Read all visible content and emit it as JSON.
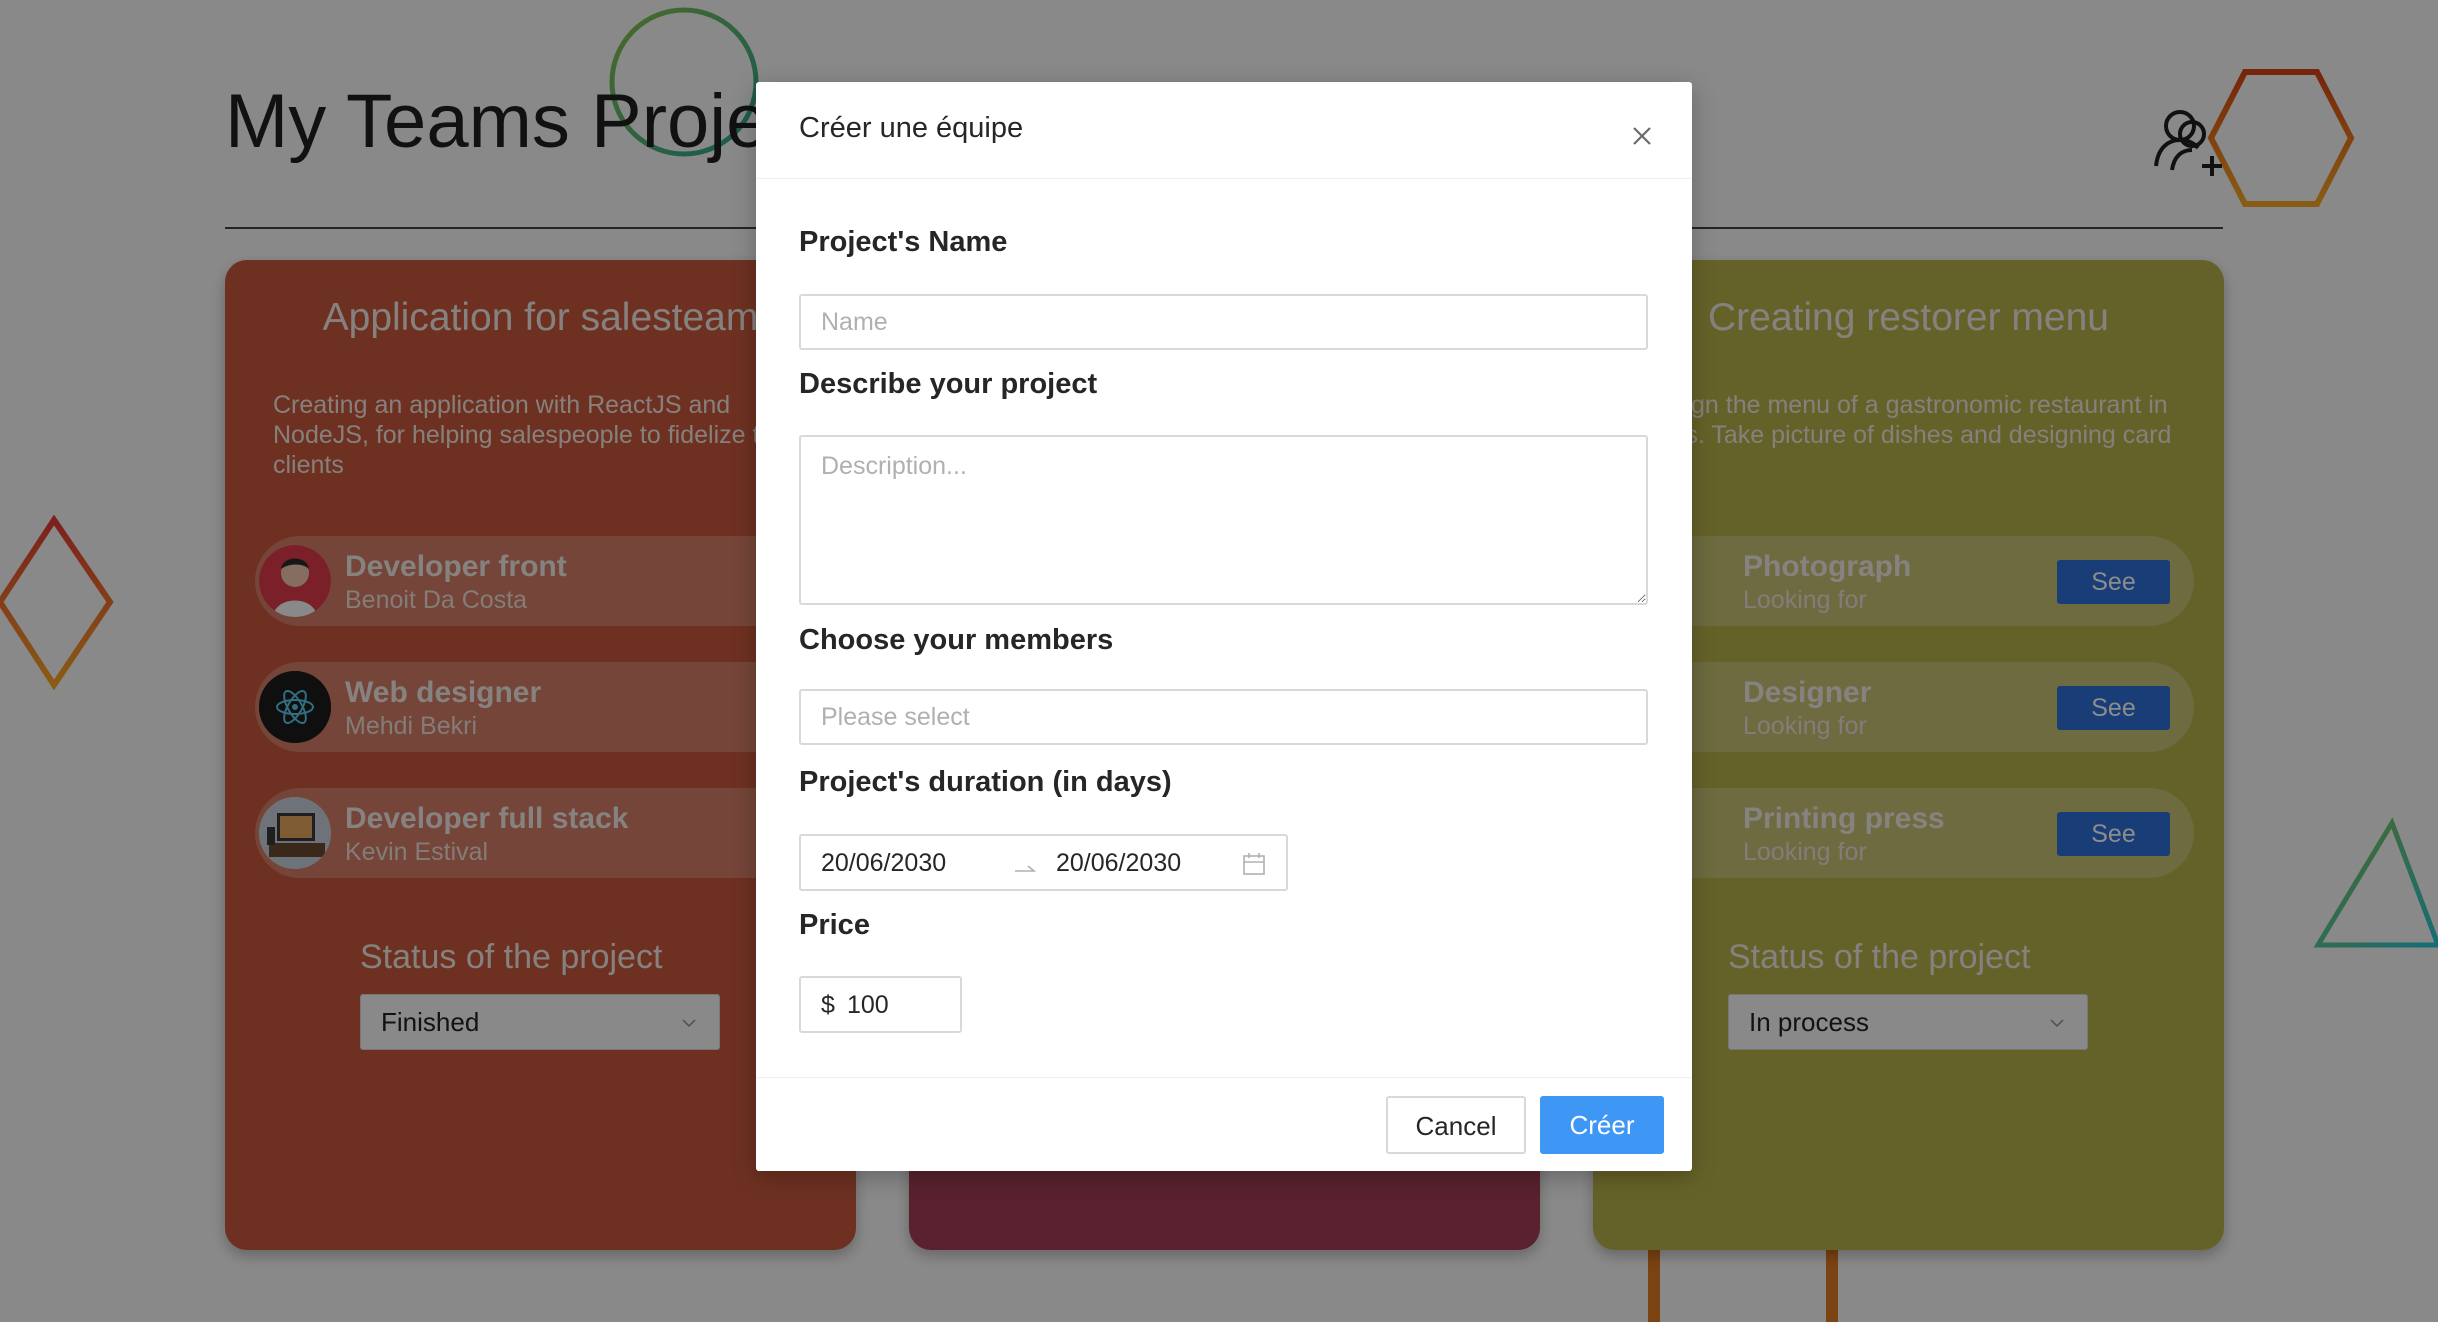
{
  "page": {
    "title": "My Teams Projects",
    "add_user_icon": "user-add-icon"
  },
  "cards": [
    {
      "title": "Application for salesteam",
      "description": "Creating an application with ReactJS and NodeJS, for helping salespeople to fidelize their clients",
      "color": "#c85a3c",
      "roles": [
        {
          "name": "Developer front",
          "sub": "Benoit Da Costa"
        },
        {
          "name": "Web designer",
          "sub": "Mehdi Bekri"
        },
        {
          "name": "Developer full stack",
          "sub": "Kevin Estival"
        }
      ],
      "status_label": "Status of the project",
      "status_value": "Finished"
    },
    {
      "title": "",
      "color": "#a23f55"
    },
    {
      "title": "Creating restorer menu",
      "description": "Design the menu of a gastronomic restaurant in Paris. Take picture of dishes and designing card",
      "color": "#b8b24c",
      "roles": [
        {
          "name": "Photograph",
          "sub": "Looking for",
          "action": "See"
        },
        {
          "name": "Designer",
          "sub": "Looking for",
          "action": "See"
        },
        {
          "name": "Printing press",
          "sub": "Looking for",
          "action": "See"
        }
      ],
      "status_label": "Status of the project",
      "status_value": "In process"
    }
  ],
  "modal": {
    "title": "Créer une équipe",
    "close_icon": "close-icon",
    "name_label": "Project's Name",
    "name_placeholder": "Name",
    "description_label": "Describe your project",
    "description_placeholder": "Description...",
    "members_label": "Choose your members",
    "members_placeholder": "Please select",
    "duration_label": "Project's duration (in days)",
    "duration_start": "20/06/2030",
    "duration_end": "20/06/2030",
    "calendar_icon": "calendar-icon",
    "price_label": "Price",
    "price_prefix": "$",
    "price_value": "100",
    "cancel_label": "Cancel",
    "create_label": "Créer",
    "primary_color": "#3f97f5"
  }
}
